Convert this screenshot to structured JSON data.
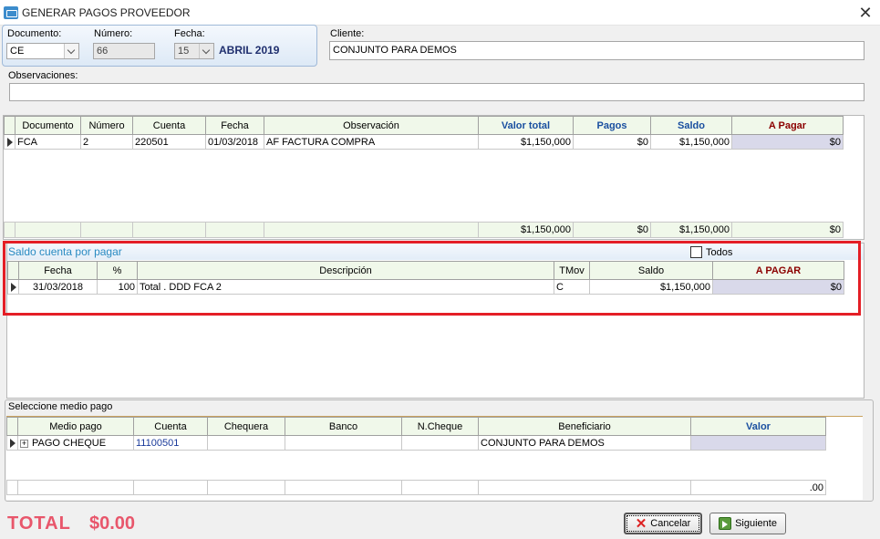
{
  "window": {
    "title": "GENERAR PAGOS  PROVEEDOR"
  },
  "header": {
    "documento_label": "Documento:",
    "documento_value": "CE",
    "numero_label": "Número:",
    "numero_value": "66",
    "fecha_label": "Fecha:",
    "fecha_day": "15",
    "fecha_month": "ABRIL 2019",
    "cliente_label": "Cliente:",
    "cliente_value": "CONJUNTO PARA DEMOS",
    "observaciones_label": "Observaciones:",
    "observaciones_value": ""
  },
  "documents_grid": {
    "columns": [
      "Documento",
      "Número",
      "Cuenta",
      "Fecha",
      "Observación",
      "Valor total",
      "Pagos",
      "Saldo",
      "A Pagar"
    ],
    "rows": [
      {
        "documento": "FCA",
        "numero": "2",
        "cuenta": "220501",
        "fecha": "01/03/2018",
        "observacion": "AF FACTURA COMPRA",
        "valor_total": "$1,150,000",
        "pagos": "$0",
        "saldo": "$1,150,000",
        "a_pagar": "$0"
      }
    ],
    "totals": {
      "valor_total": "$1,150,000",
      "pagos": "$0",
      "saldo": "$1,150,000",
      "a_pagar": "$0"
    }
  },
  "saldo_section": {
    "title": "Saldo cuenta por pagar",
    "todos_label": "Todos",
    "todos_checked": false,
    "columns": [
      "Fecha",
      "%",
      "Descripción",
      "TMov",
      "Saldo",
      "A PAGAR"
    ],
    "rows": [
      {
        "fecha": "31/03/2018",
        "porcentaje": "100",
        "descripcion": "Total . DDD  FCA 2",
        "tmov": "C",
        "saldo": "$1,150,000",
        "a_pagar": "$0"
      }
    ]
  },
  "medio_pago": {
    "title": "Seleccione medio pago",
    "columns": [
      "Medio pago",
      "Cuenta",
      "Chequera",
      "Banco",
      "N.Cheque",
      "Beneficiario",
      "Valor"
    ],
    "rows": [
      {
        "medio_pago": "PAGO CHEQUE",
        "cuenta": "11100501",
        "chequera": "",
        "banco": "",
        "n_cheque": "",
        "beneficiario": "CONJUNTO PARA DEMOS",
        "valor": ""
      }
    ],
    "total_valor": ".00"
  },
  "footer": {
    "total_label": "TOTAL",
    "total_value": "$0.00",
    "cancel_label": "Cancelar",
    "next_label": "Siguiente"
  },
  "colors": {
    "highlight_frame": "#e41e26",
    "total_text": "#e8566b",
    "header_blue": "#1a4fa0",
    "apagar_red": "#8b0000"
  }
}
